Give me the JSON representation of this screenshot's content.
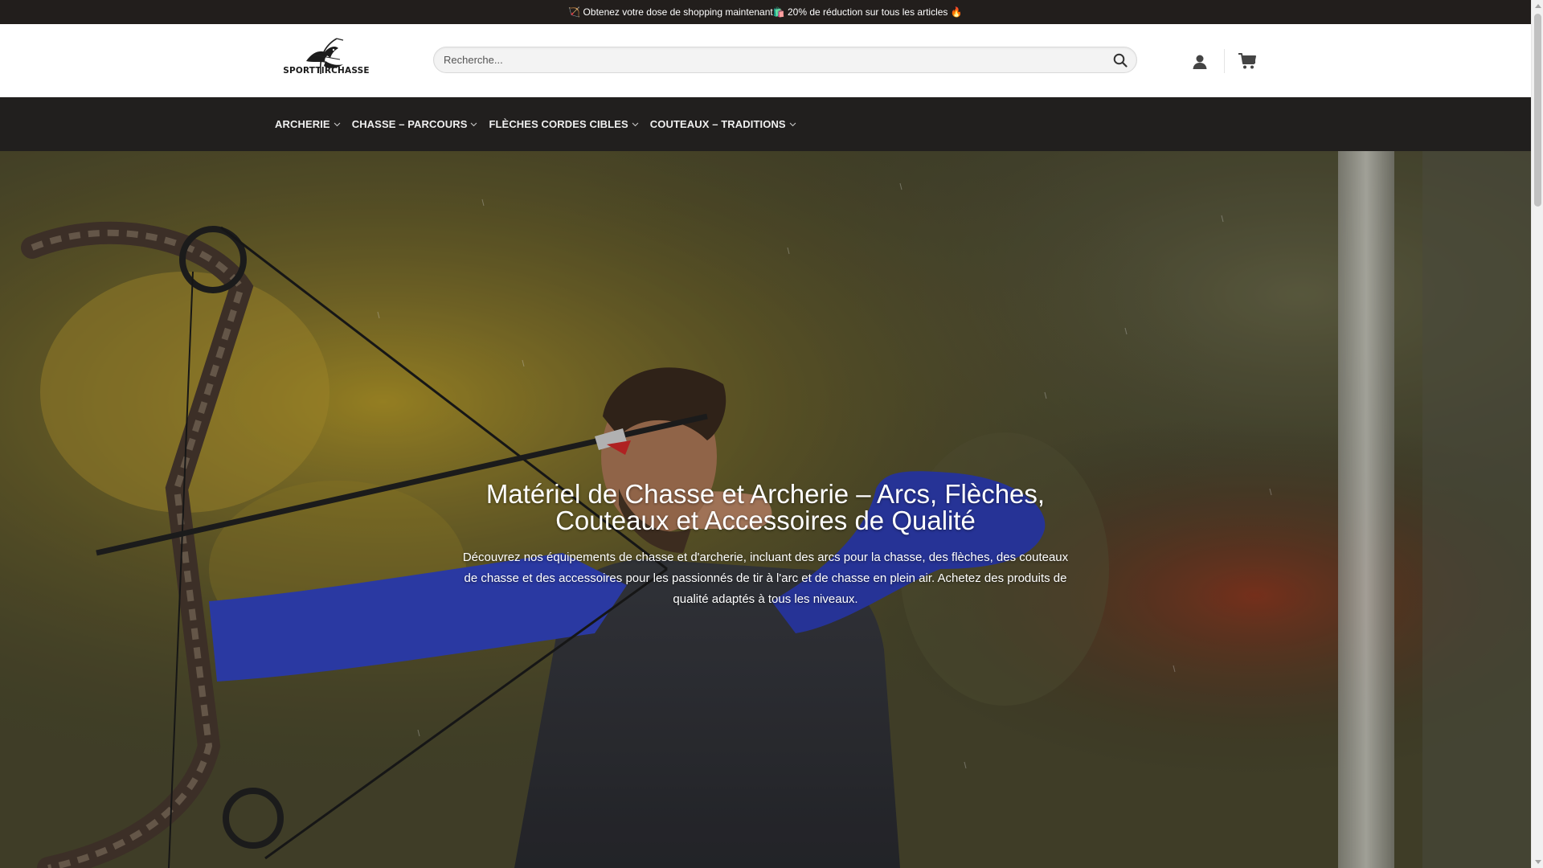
{
  "promo_bar": {
    "text": "🏹 Obtenez votre dose de shopping maintenant🛍️ 20% de réduction sur tous les articles 🔥"
  },
  "header": {
    "logo_text": "SPORTTIRCHASSE",
    "logo_icon": "eagle-bow-icon",
    "search": {
      "placeholder": "Recherche...",
      "value": "",
      "icon": "search-icon"
    },
    "account_icon": "user-icon",
    "cart_icon": "cart-icon"
  },
  "nav": {
    "items": [
      {
        "label": "ARCHERIE",
        "icon": "chevron-down-icon"
      },
      {
        "label": "CHASSE – PARCOURS",
        "icon": "chevron-down-icon"
      },
      {
        "label": "FLÈCHES CORDES CIBLES",
        "icon": "chevron-down-icon"
      },
      {
        "label": "COUTEAUX – TRADITIONS",
        "icon": "chevron-down-icon"
      }
    ]
  },
  "hero": {
    "title": "Matériel de Chasse et Archerie – Arcs, Flèches, Couteaux et Accessoires de Qualité",
    "text": "Découvrez nos équipements de chasse et d'archerie, incluant des arcs pour la chasse, des flèches, des couteaux de chasse et des accessoires pour les passionnés de tir à l'arc et de chasse en plein air. Achetez des produits de qualité adaptés à tous les niveaux."
  },
  "colors": {
    "topbar_bg": "#221e1c",
    "navbar_bg": "#211f1e",
    "nav_text": "#f0f0f0",
    "hero_text": "#ffffff"
  }
}
